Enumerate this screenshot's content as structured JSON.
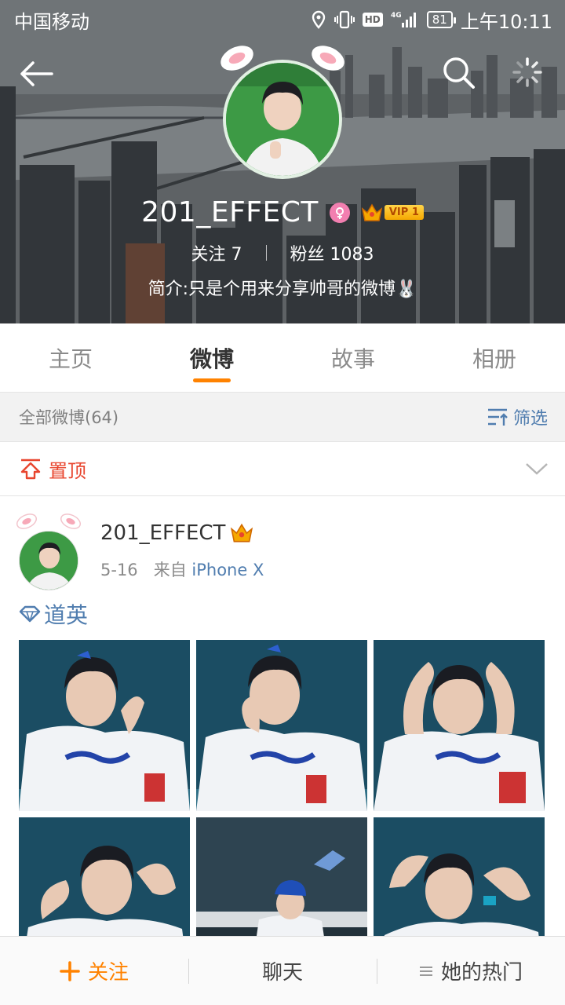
{
  "status_bar": {
    "carrier": "中国移动",
    "hd_label": "HD",
    "network": "4G",
    "battery": "81",
    "time": "上午10:11"
  },
  "profile": {
    "username": "201_EFFECT",
    "gender_icon": "female-icon",
    "vip_label": "VIP 1",
    "following_label": "关注",
    "following_count": "7",
    "followers_label": "粉丝",
    "followers_count": "1083",
    "bio": "简介:只是个用来分享帅哥的微博🐰"
  },
  "tabs": [
    {
      "label": "主页",
      "active": false
    },
    {
      "label": "微博",
      "active": true
    },
    {
      "label": "故事",
      "active": false
    },
    {
      "label": "相册",
      "active": false
    }
  ],
  "filter_bar": {
    "all_posts": "全部微博(64)",
    "filter_label": "筛选"
  },
  "pinned": {
    "label": "置顶"
  },
  "post": {
    "author": "201_EFFECT",
    "date": "5-16",
    "from_label": "来自",
    "source": "iPhone X",
    "topic": "道英",
    "photo_count": 6
  },
  "bottom_bar": {
    "follow_label": "关注",
    "chat_label": "聊天",
    "hot_label": "她的热门"
  },
  "colors": {
    "accent": "#ff8200",
    "link": "#507daf",
    "pin_red": "#e8452e",
    "gender_pink": "#f27fb0"
  }
}
